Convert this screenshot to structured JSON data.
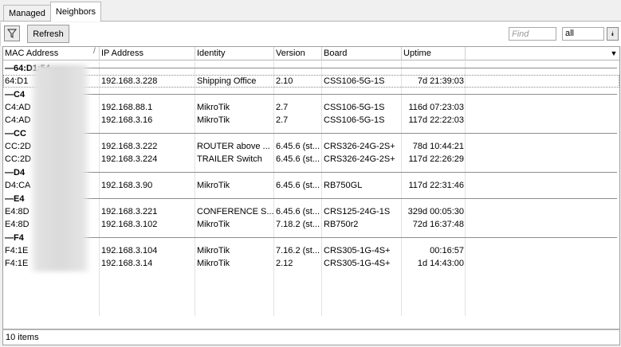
{
  "tabs": [
    {
      "label": "Managed",
      "active": false
    },
    {
      "label": "Neighbors",
      "active": true
    }
  ],
  "toolbar": {
    "filter_icon": "funnel-icon",
    "refresh_label": "Refresh",
    "find_placeholder": "Find",
    "filter_value": "all",
    "filter_dropdown_icon": "dropdown-arrow-icon"
  },
  "table": {
    "columns": [
      "MAC Address",
      "IP Address",
      "Identity",
      "Version",
      "Board",
      "Uptime"
    ],
    "sort_marker": "/",
    "column_menu_icon": "column-dropdown-icon",
    "groups": [
      {
        "label": "64:D1:54",
        "rows": [
          {
            "mac": "64:D1",
            "ip": "192.168.3.228",
            "identity": "Shipping Office",
            "version": "2.10",
            "board": "CSS106-5G-1S",
            "uptime": "7d 21:39:03",
            "selected": true
          }
        ]
      },
      {
        "label": "C4",
        "rows": [
          {
            "mac": "C4:AD",
            "ip": "192.168.88.1",
            "identity": "MikroTik",
            "version": "2.7",
            "board": "CSS106-5G-1S",
            "uptime": "116d 07:23:03",
            "selected": false
          },
          {
            "mac": "C4:AD",
            "ip": "192.168.3.16",
            "identity": "MikroTik",
            "version": "2.7",
            "board": "CSS106-5G-1S",
            "uptime": "117d 22:22:03",
            "selected": false
          }
        ]
      },
      {
        "label": "CC",
        "rows": [
          {
            "mac": "CC:2D",
            "ip": "192.168.3.222",
            "identity": "ROUTER above ...",
            "version": "6.45.6 (st...",
            "board": "CRS326-24G-2S+",
            "uptime": "78d 10:44:21",
            "selected": false
          },
          {
            "mac": "CC:2D",
            "ip": "192.168.3.224",
            "identity": "TRAILER Switch",
            "version": "6.45.6 (st...",
            "board": "CRS326-24G-2S+",
            "uptime": "117d 22:26:29",
            "selected": false
          }
        ]
      },
      {
        "label": "D4",
        "rows": [
          {
            "mac": "D4:CA",
            "ip": "192.168.3.90",
            "identity": "MikroTik",
            "version": "6.45.6 (st...",
            "board": "RB750GL",
            "uptime": "117d 22:31:46",
            "selected": false
          }
        ]
      },
      {
        "label": "E4",
        "rows": [
          {
            "mac": "E4:8D",
            "ip": "192.168.3.221",
            "identity": "CONFERENCE S...",
            "version": "6.45.6 (st...",
            "board": "CRS125-24G-1S",
            "uptime": "329d 00:05:30",
            "selected": false
          },
          {
            "mac": "E4:8D",
            "ip": "192.168.3.102",
            "identity": "MikroTik",
            "version": "7.18.2 (st...",
            "board": "RB750r2",
            "uptime": "72d 16:37:48",
            "selected": false
          }
        ]
      },
      {
        "label": "F4",
        "rows": [
          {
            "mac": "F4:1E",
            "ip": "192.168.3.104",
            "identity": "MikroTik",
            "version": "7.16.2 (st...",
            "board": "CRS305-1G-4S+",
            "uptime": "00:16:57",
            "selected": false
          },
          {
            "mac": "F4:1E",
            "ip": "192.168.3.14",
            "identity": "MikroTik",
            "version": "2.12",
            "board": "CRS305-1G-4S+",
            "uptime": "1d 14:43:00",
            "selected": false
          }
        ]
      }
    ]
  },
  "status": {
    "count_text": "10 items"
  }
}
